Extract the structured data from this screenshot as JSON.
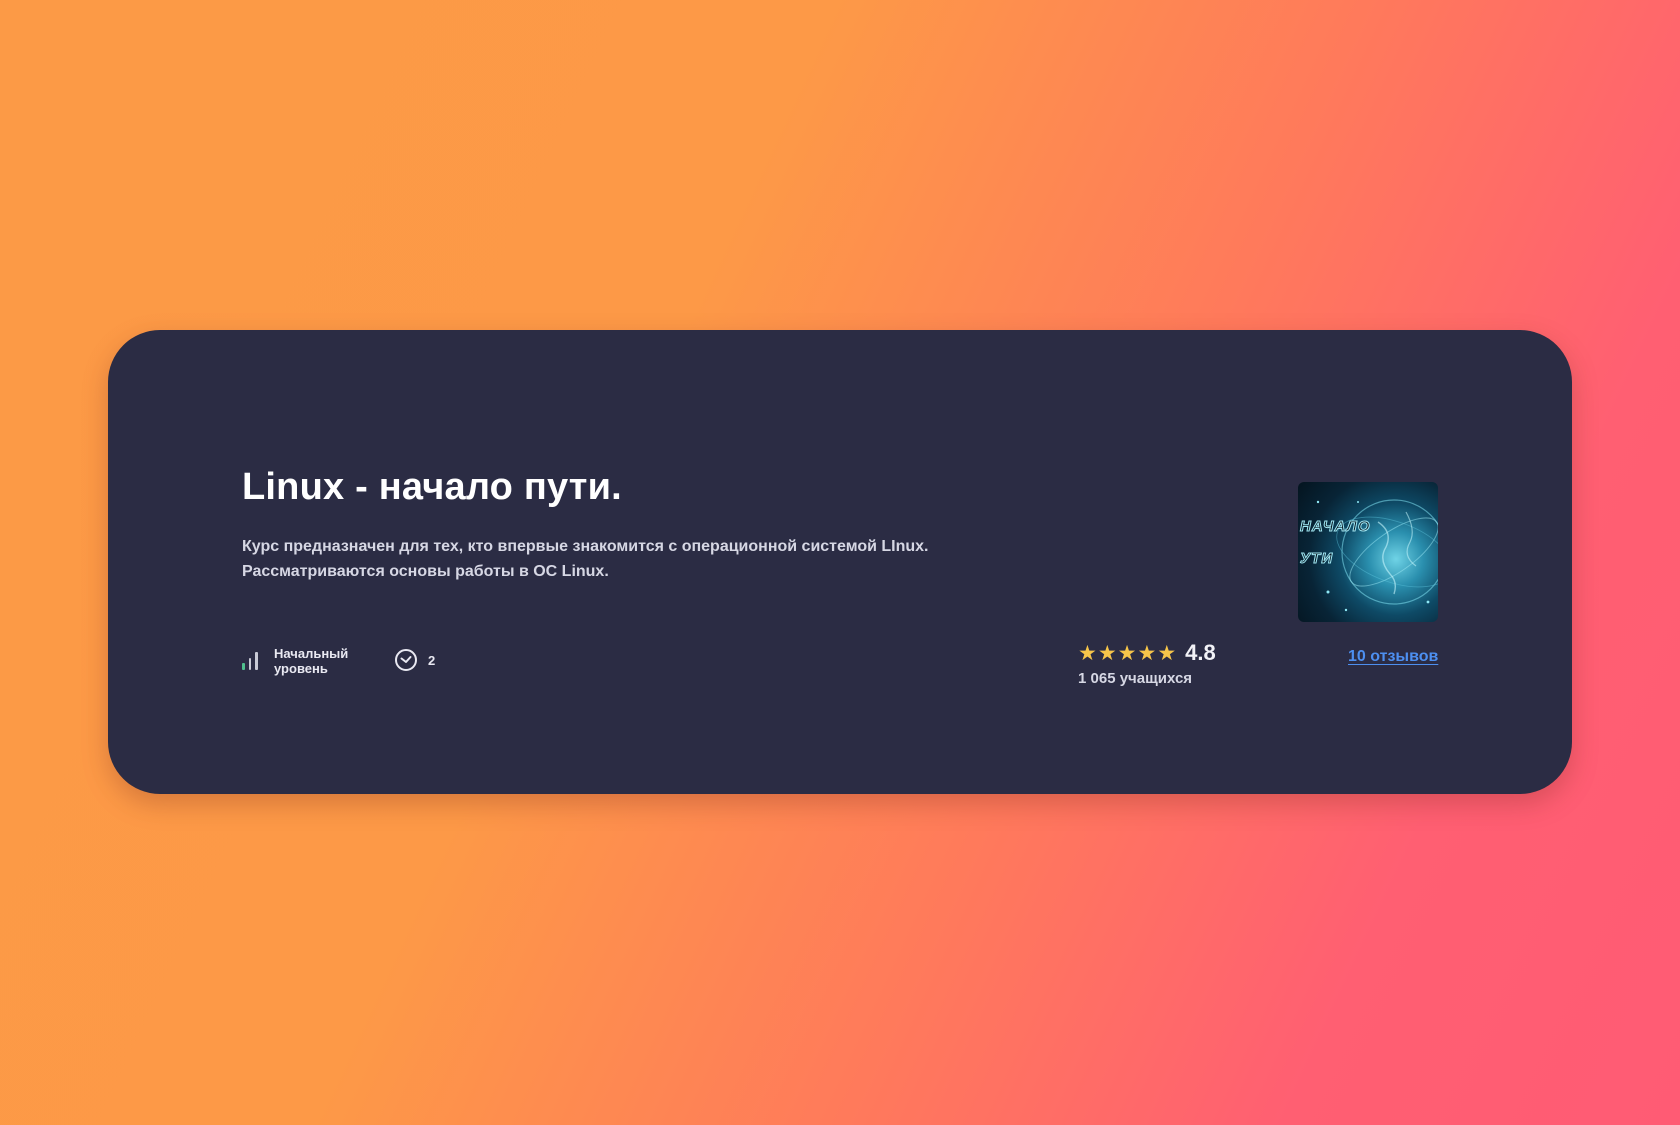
{
  "course": {
    "title": "Linux - начало пути.",
    "description_lines": [
      "Курс предназначен для тех, кто впервые знакомится с операционной системой LInux.",
      "Рассматриваются основы работы в ОС Linux."
    ],
    "cover": {
      "text_lines": [
        "НАЧАЛО",
        "УТИ"
      ],
      "icon": "globe-cover-image"
    }
  },
  "meta": {
    "level_label": "Начальный уровень",
    "level_icon": "signal-bars-icon",
    "time_icon": "clock-icon",
    "time_value": "2"
  },
  "rating": {
    "value": "4.8",
    "stars_filled": 5,
    "students": "1 065 учащихся",
    "reviews_link": "10 отзывов"
  },
  "colors": {
    "card_bg": "#2b2c44",
    "star": "#f6c54a",
    "link": "#4d8ff0",
    "bar_green": "#4fc08d",
    "bar_muted": "#c9cad6",
    "gradient_start": "#fc9a46",
    "gradient_end": "#ff5b74"
  }
}
